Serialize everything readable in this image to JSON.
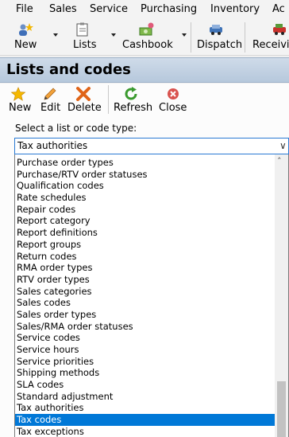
{
  "menu": {
    "file": "File",
    "sales": "Sales",
    "service": "Service",
    "purchasing": "Purchasing",
    "inventory": "Inventory",
    "overflow": "Ac"
  },
  "toolbar": {
    "new": "New",
    "lists": "Lists",
    "cashbook": "Cashbook",
    "dispatch": "Dispatch",
    "receiving": "Receivi"
  },
  "header": {
    "title": "Lists and codes"
  },
  "panel_toolbar": {
    "new": "New",
    "edit": "Edit",
    "delete": "Delete",
    "refresh": "Refresh",
    "close": "Close"
  },
  "selector": {
    "label": "Select a list or code type:",
    "value": "Tax authorities",
    "chevron": "∨",
    "scroll_up": "˄"
  },
  "list": {
    "items": [
      "Purchase order types",
      "Purchase/RTV order statuses",
      "Qualification codes",
      "Rate schedules",
      "Repair codes",
      "Report category",
      "Report definitions",
      "Report groups",
      "Return codes",
      "RMA order types",
      "RTV order types",
      "Sales categories",
      "Sales codes",
      "Sales order types",
      "Sales/RMA order statuses",
      "Service codes",
      "Service hours",
      "Service priorities",
      "Shipping methods",
      "SLA codes",
      "Standard adjustment",
      "Tax authorities",
      "Tax codes",
      "Tax exceptions"
    ],
    "selected_index": 22
  },
  "colors": {
    "selection": "#0078d7",
    "header_bg": "#c4d3e4",
    "dropdown_border": "#2a7ad3"
  },
  "icons": {
    "toolbar_new": "people-star-icon",
    "toolbar_lists": "clipboard-icon",
    "toolbar_cashbook": "money-icon",
    "toolbar_dispatch": "truck-icon",
    "toolbar_receiving": "truck-red-icon",
    "panel_new": "star-icon",
    "panel_edit": "pencil-icon",
    "panel_delete": "red-x-icon",
    "panel_refresh": "refresh-icon",
    "panel_close": "close-circle-icon"
  }
}
